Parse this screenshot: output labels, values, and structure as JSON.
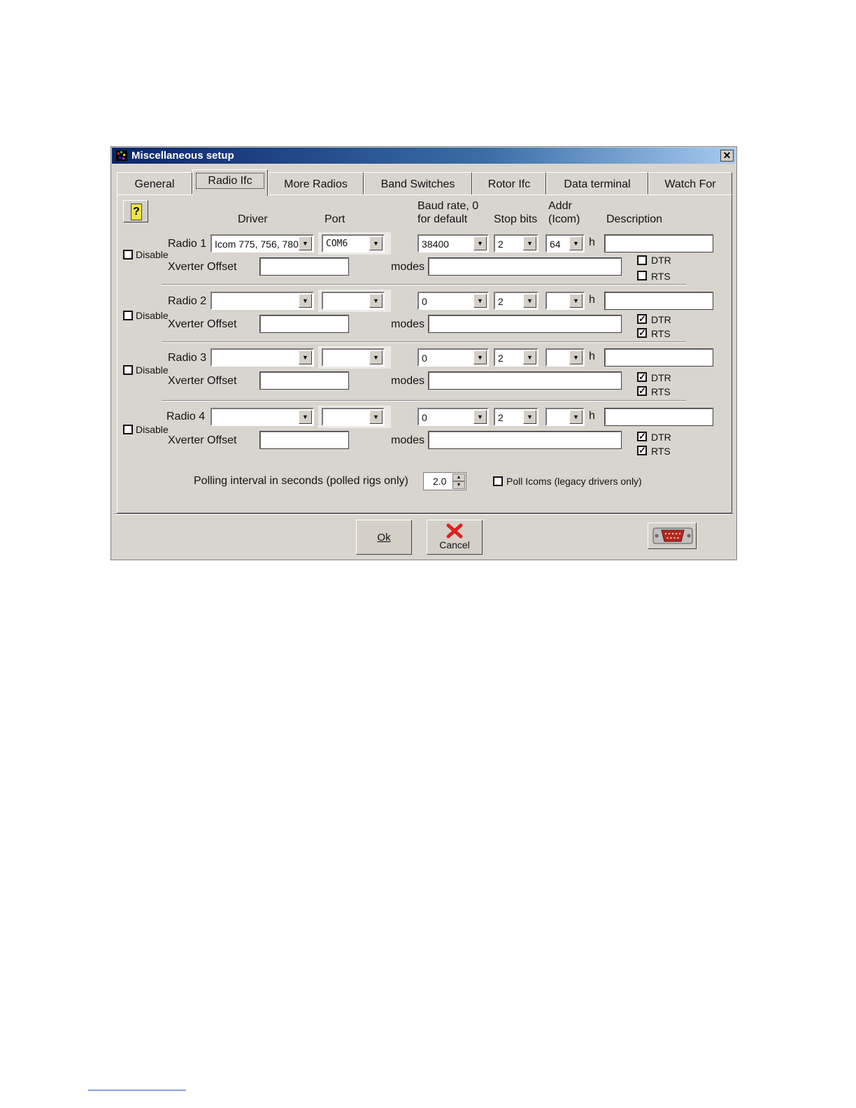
{
  "window": {
    "title": "Miscellaneous setup",
    "close_glyph": "✕"
  },
  "tabs": [
    "General",
    "Radio Ifc",
    "More Radios",
    "Band Switches",
    "Rotor Ifc",
    "Data terminal",
    "Watch For"
  ],
  "active_tab": "Radio Ifc",
  "help_button": {
    "glyph": "?",
    "icon": "help-icon"
  },
  "headers": {
    "driver": "Driver",
    "port": "Port",
    "baud_line1": "Baud rate, 0",
    "baud_line2": "for default",
    "stop_bits": "Stop bits",
    "addr_line1": "Addr",
    "addr_line2": "(Icom)",
    "description": "Description"
  },
  "labels": {
    "disable": "Disable",
    "xverter": "Xverter Offset",
    "modes": "modes",
    "hex": "h",
    "dtr": "DTR",
    "rts": "RTS"
  },
  "radios": [
    {
      "label": "Radio 1",
      "disable": false,
      "driver": "Icom 775, 756, 780",
      "port": "COM6",
      "baud": "38400",
      "stop_bits": "2",
      "addr": "64",
      "description": "",
      "xverter": "",
      "modes": "",
      "dtr": false,
      "rts": false
    },
    {
      "label": "Radio 2",
      "disable": false,
      "driver": "",
      "port": "",
      "baud": "0",
      "stop_bits": "2",
      "addr": "",
      "description": "",
      "xverter": "",
      "modes": "",
      "dtr": true,
      "rts": true
    },
    {
      "label": "Radio 3",
      "disable": false,
      "driver": "",
      "port": "",
      "baud": "0",
      "stop_bits": "2",
      "addr": "",
      "description": "",
      "xverter": "",
      "modes": "",
      "dtr": true,
      "rts": true
    },
    {
      "label": "Radio 4",
      "disable": false,
      "driver": "",
      "port": "",
      "baud": "0",
      "stop_bits": "2",
      "addr": "",
      "description": "",
      "xverter": "",
      "modes": "",
      "dtr": true,
      "rts": true
    }
  ],
  "polling": {
    "label": "Polling interval in seconds (polled rigs only)",
    "value": "2.0"
  },
  "poll_icoms": {
    "label": "Poll Icoms (legacy drivers only)",
    "checked": false
  },
  "buttons": {
    "ok": "Ok",
    "cancel": "Cancel",
    "serial_icon": "serial-port-icon"
  },
  "colors": {
    "titlebar_start": "#0a246a",
    "titlebar_end": "#a6caf0",
    "dialog_bg": "#d8d5cf",
    "cancel_x": "#e0201c"
  }
}
